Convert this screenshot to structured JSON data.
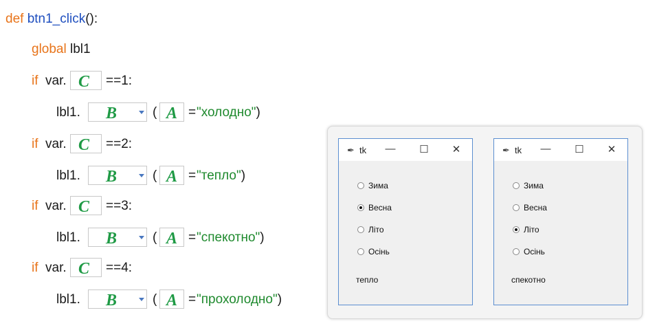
{
  "code": {
    "def_kw": "def",
    "func_name": "btn1_click",
    "func_tail": "():",
    "global_kw": "global",
    "global_var": "lbl1",
    "if_kw": "if",
    "var_prefix": "var.",
    "lbl_prefix": "lbl1.",
    "paren_open": "(",
    "paren_close": ")",
    "eq": "=",
    "blank_a": "A",
    "blank_b": "B",
    "blank_c": "C",
    "conditions": [
      "==1:",
      "==2:",
      "==3:",
      "==4:"
    ],
    "strings": [
      "\"холодно\"",
      "\"тепло\"",
      "\"спекотно\"",
      "\"прохолодно\""
    ]
  },
  "windows": [
    {
      "title": "tk",
      "controls": [
        "—",
        "☐",
        "✕"
      ],
      "options": [
        "Зима",
        "Весна",
        "Літо",
        "Осінь"
      ],
      "selected_index": 1,
      "label": "тепло"
    },
    {
      "title": "tk",
      "controls": [
        "—",
        "☐",
        "✕"
      ],
      "options": [
        "Зима",
        "Весна",
        "Літо",
        "Осінь"
      ],
      "selected_index": 2,
      "label": "спекотно"
    }
  ],
  "colors": {
    "keyword": "#e8741a",
    "function": "#1f4fbf",
    "string": "#1f8a2e",
    "blank_letter": "#1f9a45",
    "window_border": "#5b8ed0"
  }
}
